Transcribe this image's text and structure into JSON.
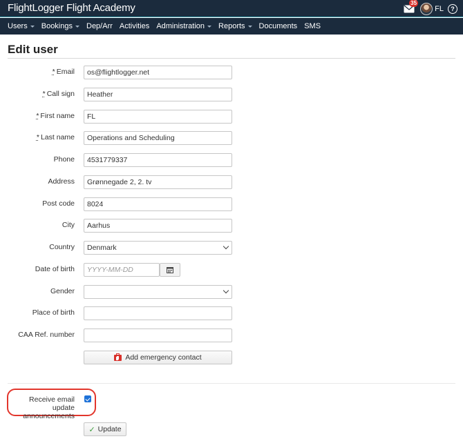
{
  "app": {
    "title": "FlightLogger Flight Academy",
    "mail_count": "35",
    "user_initials": "FL",
    "help_glyph": "?"
  },
  "nav": [
    {
      "label": "Users",
      "has_menu": true
    },
    {
      "label": "Bookings",
      "has_menu": true
    },
    {
      "label": "Dep/Arr",
      "has_menu": false
    },
    {
      "label": "Activities",
      "has_menu": false
    },
    {
      "label": "Administration",
      "has_menu": true
    },
    {
      "label": "Reports",
      "has_menu": true
    },
    {
      "label": "Documents",
      "has_menu": false
    },
    {
      "label": "SMS",
      "has_menu": false
    }
  ],
  "page": {
    "title": "Edit user"
  },
  "form": {
    "email": {
      "label": "Email",
      "required_mark": "*",
      "value": "os@flightlogger.net"
    },
    "call_sign": {
      "label": "Call sign",
      "required_mark": "*",
      "value": "Heather"
    },
    "first_name": {
      "label": "First name",
      "required_mark": "*",
      "value": "FL"
    },
    "last_name": {
      "label": "Last name",
      "required_mark": "*",
      "value": "Operations and Scheduling"
    },
    "phone": {
      "label": "Phone",
      "value": "4531779337"
    },
    "address": {
      "label": "Address",
      "value": "Grønnegade 2, 2. tv"
    },
    "post_code": {
      "label": "Post code",
      "value": "8024"
    },
    "city": {
      "label": "City",
      "value": "Aarhus"
    },
    "country": {
      "label": "Country",
      "value": "Denmark"
    },
    "date_of_birth": {
      "label": "Date of birth",
      "placeholder": "YYYY-MM-DD"
    },
    "gender": {
      "label": "Gender",
      "value": ""
    },
    "place_of_birth": {
      "label": "Place of birth",
      "value": ""
    },
    "caa_ref": {
      "label": "CAA Ref. number",
      "value": ""
    },
    "emergency_button": "Add emergency contact",
    "email_updates": {
      "label": "Receive email update announcements",
      "checked": true
    },
    "update_button": "Update"
  },
  "colors": {
    "navbar": "#1b2b3d",
    "highlight": "#e2352b",
    "checkbox": "#1e72d8",
    "badge": "#d9312b"
  }
}
